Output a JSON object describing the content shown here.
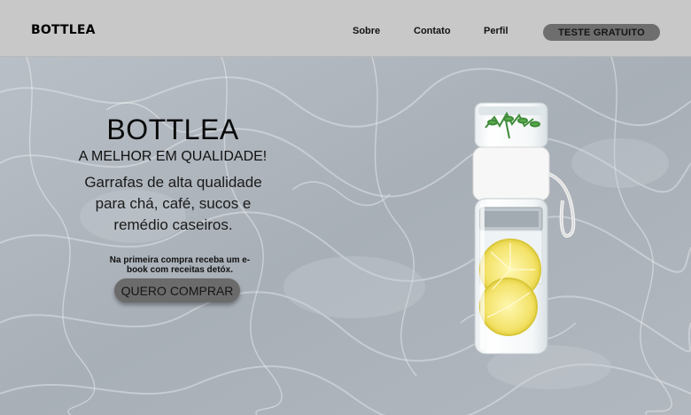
{
  "header": {
    "logo": "BOTTLEA",
    "nav": [
      "Sobre",
      "Contato",
      "Perfil"
    ],
    "cta": "TESTE GRATUITO"
  },
  "hero": {
    "title": "BOTTLEA",
    "subtitle": "A MELHOR EM QUALIDADE!",
    "description": "Garrafas de alta qualidade para chá, café, sucos e remédio caseiros.",
    "promo": "Na primeira compra receba um e-book com receitas detóx.",
    "button": "QUERO COMPRAR"
  },
  "colors": {
    "header_bg": "#c8c8c8",
    "button_bg": "#6e6e6e"
  },
  "icons": [
    "bottle-product-image",
    "water-background"
  ]
}
